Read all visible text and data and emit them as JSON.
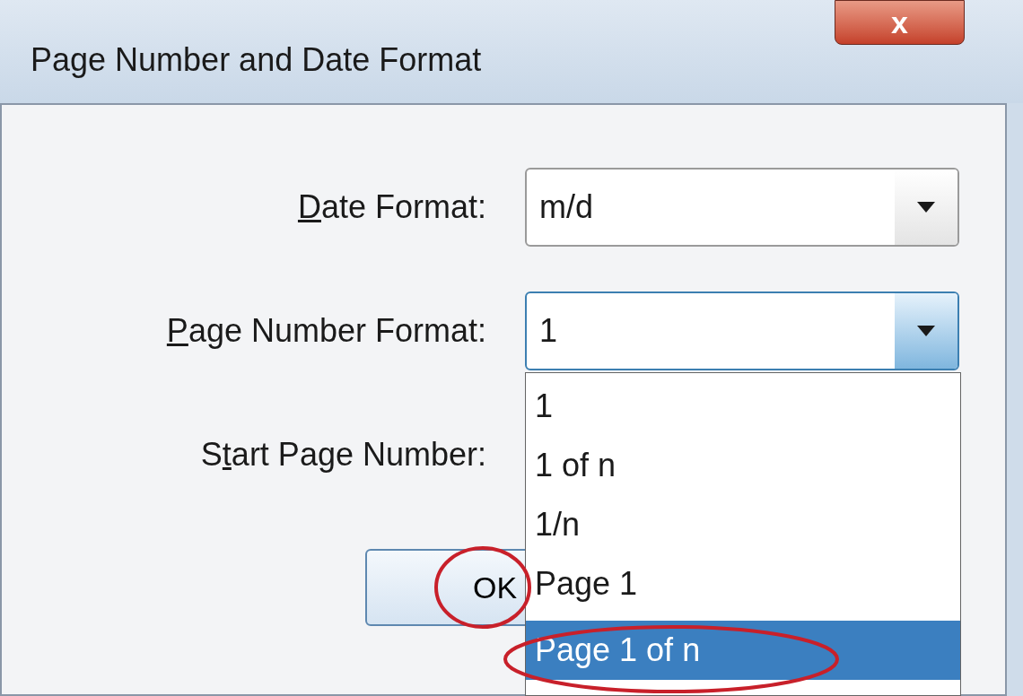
{
  "window": {
    "title": "Page Number and Date Format",
    "close_label": "x"
  },
  "fields": [
    {
      "kind": "combo",
      "label": [
        {
          "text": "D",
          "underline": true
        },
        {
          "text": "ate Format:",
          "underline": false
        }
      ],
      "value": "m/d",
      "focused": false
    },
    {
      "kind": "combo",
      "label": [
        {
          "text": "P",
          "underline": true
        },
        {
          "text": "age Number Format:",
          "underline": false
        }
      ],
      "value": "1",
      "focused": true
    },
    {
      "kind": "label",
      "label": [
        {
          "text": "S",
          "underline": false
        },
        {
          "text": "t",
          "underline": true
        },
        {
          "text": "art Page Number:",
          "underline": false
        }
      ]
    }
  ],
  "buttons": [
    "OK"
  ],
  "dropdown": {
    "items": [
      {
        "label": "1",
        "selected": false
      },
      {
        "label": "1 of n",
        "selected": false
      },
      {
        "label": "1/n",
        "selected": false
      },
      {
        "label": "Page 1",
        "selected": false
      },
      {
        "label": "Page 1 of n",
        "selected": true
      }
    ]
  }
}
